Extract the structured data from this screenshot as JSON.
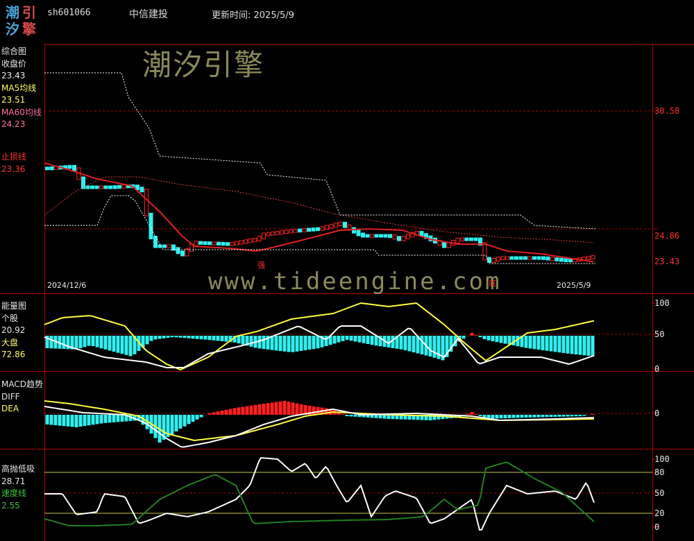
{
  "header": {
    "logo_chars": [
      "潮",
      "引",
      "汐",
      "擎"
    ],
    "stock_code": "sh601066",
    "stock_name": "中信建投",
    "update_time": "更新时间: 2025/5/9"
  },
  "watermarks": {
    "brand": "潮汐引擎",
    "url": "www.tideengine.com"
  },
  "panel_main": {
    "title": "综合图",
    "close_label": "收盘价",
    "close_value": "23.43",
    "ma5_label": "MA5均线",
    "ma5_value": "23.51",
    "ma60_label": "MA60均线",
    "ma60_value": "24.23",
    "stop_label": "止损线",
    "stop_value": "23.36",
    "right_levels": [
      "30.58",
      "24.86",
      "23.43"
    ],
    "date_start": "2024/12/6",
    "date_end": "2025/5/9",
    "marker_strong": "强",
    "marker_bottom": "底"
  },
  "panel_energy": {
    "title": "能量图",
    "stock_label": "个股",
    "stock_value": "20.92",
    "market_label": "大盘",
    "market_value": "72.86",
    "right_levels": [
      "100",
      "50",
      "0"
    ]
  },
  "panel_macd": {
    "title": "MACD趋势",
    "diff_label": "DIFF",
    "dea_label": "DEA",
    "right_levels": [
      "0"
    ]
  },
  "panel_kdj": {
    "title": "高抛低吸",
    "value1": "28.71",
    "speed_label": "速度线",
    "speed_value": "2.55",
    "right_levels": [
      "100",
      "80",
      "50",
      "20",
      "0"
    ]
  },
  "colors": {
    "grid_red": "#b00000",
    "up": "#ff2020",
    "down": "#30f0f0",
    "ma5": "#e02020",
    "line_white": "#ffffff",
    "line_yellow": "#ffff40",
    "line_green": "#208020"
  }
}
